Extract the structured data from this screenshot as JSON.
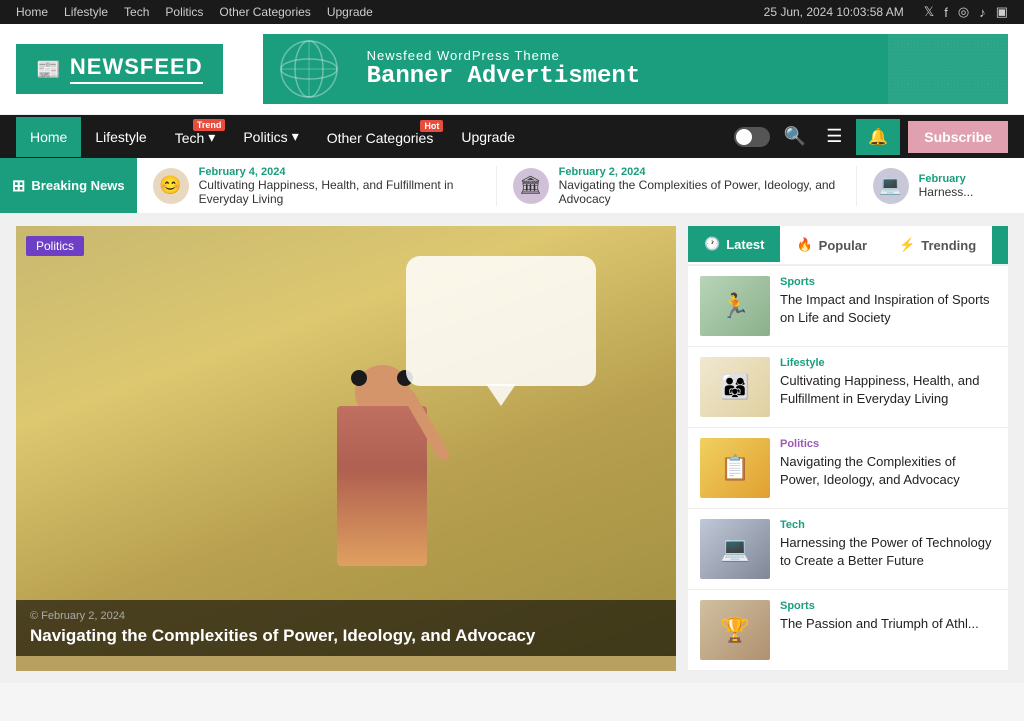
{
  "topbar": {
    "nav_items": [
      "Home",
      "Lifestyle",
      "Tech",
      "Politics",
      "Other Categories",
      "Upgrade"
    ],
    "datetime": "25 Jun, 2024  10:03:58 AM",
    "social_icons": [
      "𝕏",
      "f",
      "📷",
      "♪",
      "🎵"
    ]
  },
  "header": {
    "logo_text": "NEWSFEED",
    "ad_line1": "Newsfeed WordPress Theme",
    "ad_line2": "Banner Advertisment"
  },
  "nav": {
    "items": [
      {
        "label": "Home",
        "active": true,
        "badge": null
      },
      {
        "label": "Lifestyle",
        "active": false,
        "badge": null
      },
      {
        "label": "Tech",
        "active": false,
        "badge": "Trend",
        "badge_type": "trend"
      },
      {
        "label": "Politics",
        "active": false,
        "badge": null
      },
      {
        "label": "Other Categories",
        "active": false,
        "badge": "Hot",
        "badge_type": "hot"
      },
      {
        "label": "Upgrade",
        "active": false,
        "badge": null
      }
    ],
    "subscribe_label": "Subscribe",
    "notify_icon": "🔔"
  },
  "breaking_news": {
    "label": "Breaking News",
    "items": [
      {
        "date": "February 4, 2024",
        "title": "Cultivating Happiness, Health, and Fulfillment in Everyday Living",
        "avatar": "😊"
      },
      {
        "date": "February 2, 2024",
        "title": "Navigating the Complexities of Power, Ideology, and Advocacy",
        "avatar": "🏛"
      },
      {
        "date": "February",
        "title": "Harness...",
        "avatar": "💻"
      }
    ]
  },
  "featured": {
    "tag": "Politics",
    "date": "© February 2, 2024",
    "title": "Navigating the Complexities of Power, Ideology, and Advocacy"
  },
  "sidebar": {
    "tabs": [
      {
        "label": "Latest",
        "active": true,
        "icon": "🕐"
      },
      {
        "label": "Popular",
        "active": false,
        "icon": "🔥"
      },
      {
        "label": "Trending",
        "active": false,
        "icon": "⚡"
      }
    ],
    "articles": [
      {
        "category": "Sports",
        "cat_class": "cat-sports",
        "thumb_class": "thumb-sports1",
        "thumb_icon": "🏃",
        "title": "The Impact and Inspiration of Sports on Life and Society"
      },
      {
        "category": "Lifestyle",
        "cat_class": "cat-lifestyle",
        "thumb_class": "thumb-lifestyle",
        "thumb_icon": "👨‍👩‍👧",
        "title": "Cultivating Happiness, Health, and Fulfillment in Everyday Living"
      },
      {
        "category": "Politics",
        "cat_class": "cat-politics",
        "thumb_class": "thumb-politics",
        "thumb_icon": "📋",
        "title": "Navigating the Complexities of Power, Ideology, and Advocacy"
      },
      {
        "category": "Tech",
        "cat_class": "cat-tech",
        "thumb_class": "thumb-tech",
        "thumb_icon": "💻",
        "title": "Harnessing the Power of Technology to Create a Better Future"
      },
      {
        "category": "Sports",
        "cat_class": "cat-sports",
        "thumb_class": "thumb-sports2",
        "thumb_icon": "🏆",
        "title": "The Passion and Triumph of Athl..."
      }
    ]
  }
}
